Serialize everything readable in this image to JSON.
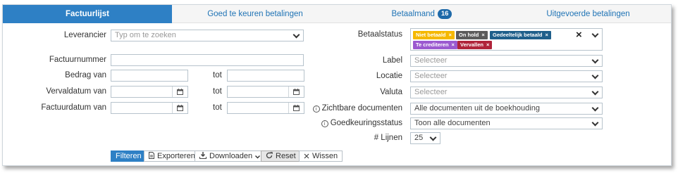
{
  "tabs": [
    {
      "label": "Factuurlijst",
      "active": true
    },
    {
      "label": "Goed te keuren betalingen"
    },
    {
      "label": "Betaalmand",
      "badge": "16"
    },
    {
      "label": "Uitgevoerde betalingen"
    }
  ],
  "filters": {
    "leverancier": {
      "label": "Leverancier",
      "placeholder": "Typ om te zoeken"
    },
    "factuurnummer": {
      "label": "Factuurnummer",
      "value": ""
    },
    "bedrag": {
      "label": "Bedrag van",
      "to_label": "tot"
    },
    "vervaldatum": {
      "label": "Vervaldatum van",
      "to_label": "tot"
    },
    "factuurdatum": {
      "label": "Factuurdatum van",
      "to_label": "tot"
    },
    "betaalstatus": {
      "label": "Betaalstatus",
      "tags": [
        {
          "label": "Niet betaald",
          "color": "#f5b800"
        },
        {
          "label": "On hold",
          "color": "#5b5b5b"
        },
        {
          "label": "Gedeeltelijk betaald",
          "color": "#1f5f8b"
        },
        {
          "label": "Te crediteren",
          "color": "#9b59d0"
        },
        {
          "label": "Vervallen",
          "color": "#b0243a"
        }
      ],
      "remove_glyph": "×",
      "clear_glyph": "×"
    },
    "label": {
      "label": "Label",
      "value": "Selecteer"
    },
    "locatie": {
      "label": "Locatie",
      "value": "Selecteer"
    },
    "valuta": {
      "label": "Valuta",
      "value": "Selecteer"
    },
    "zichtbare_documenten": {
      "label": "Zichtbare documenten",
      "value": "Alle documenten uit de boekhouding",
      "info": "i"
    },
    "goedkeuringsstatus": {
      "label": "Goedkeuringsstatus",
      "value": "Toon alle documenten",
      "info": "i"
    },
    "lijnen": {
      "label": "# Lijnen",
      "value": "25"
    }
  },
  "actions": {
    "filteren": "Filteren",
    "exporteren": "Exporteren",
    "downloaden": "Downloaden",
    "reset": "Reset",
    "wissen": "Wissen"
  }
}
